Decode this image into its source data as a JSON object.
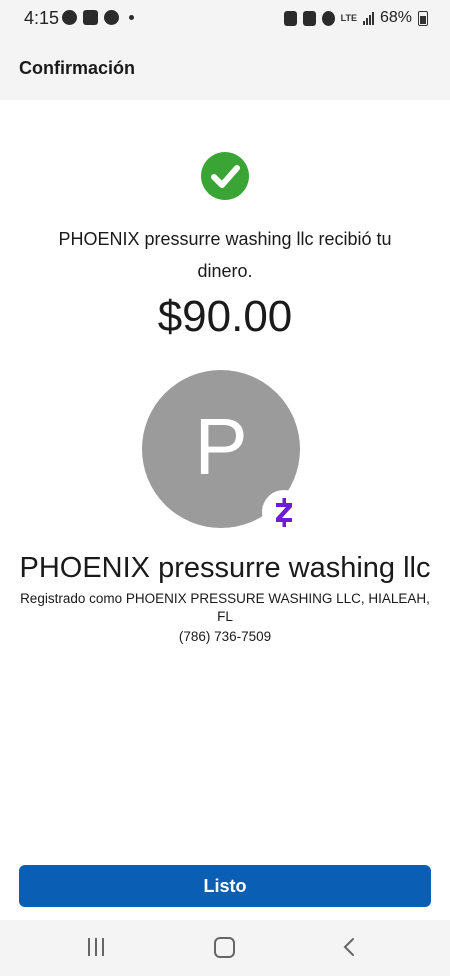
{
  "status_bar": {
    "time": "4:15",
    "network": "LTE",
    "battery": "68%"
  },
  "header": {
    "title": "Confirmación"
  },
  "confirmation": {
    "message": "PHOENIX pressurre washing llc recibió tu dinero.",
    "amount": "$90.00",
    "avatar_letter": "P",
    "recipient_name": "PHOENIX pressurre washing llc",
    "registered_as": "Registrado como PHOENIX PRESSURE WASHING LLC, HIALEAH, FL",
    "phone": "(786) 736-7509",
    "badge_icon": "zelle-icon"
  },
  "actions": {
    "done_label": "Listo"
  },
  "colors": {
    "accent": "#0a5fb4",
    "success": "#3aa535",
    "zelle": "#6d1ed4",
    "avatar_bg": "#9b9b9b"
  }
}
